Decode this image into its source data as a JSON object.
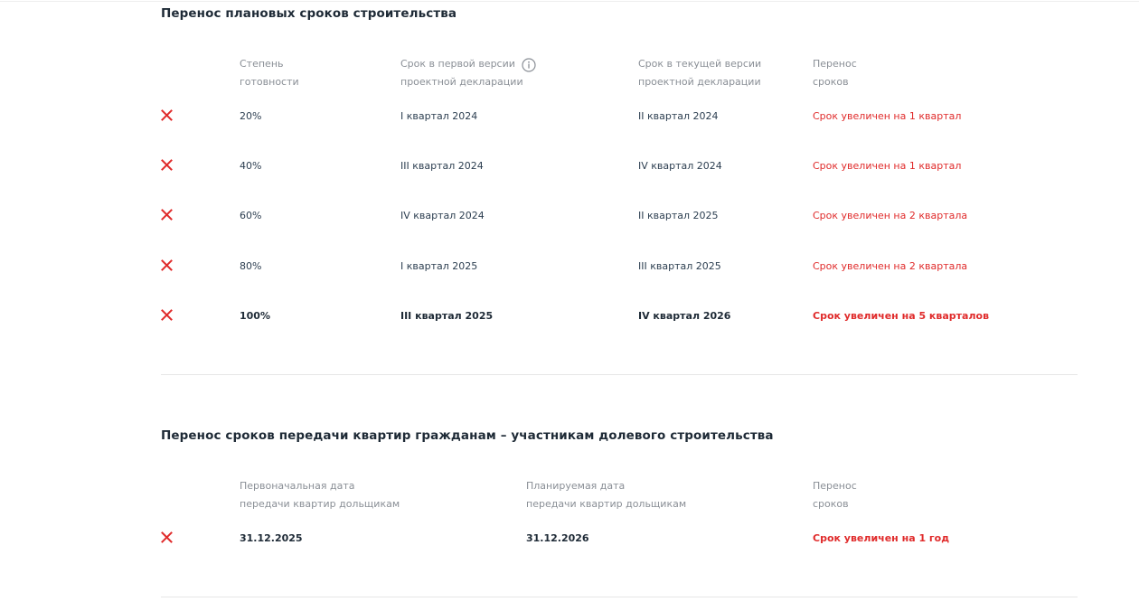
{
  "colors": {
    "title": "#1e2a36",
    "header": "#8a8f96",
    "text": "#2c3e50",
    "alert": "#e02b2b",
    "divider": "#e6e6e6"
  },
  "icons": {
    "row_status": "close-icon",
    "header_info": "info-icon"
  },
  "construction": {
    "title": "Перенос плановых сроков строительства",
    "headers": [
      {
        "line1": "Степень",
        "line2": "готовности"
      },
      {
        "line1": "Срок в первой версии",
        "line2": "проектной декларации"
      },
      {
        "line1": "Срок в текущей версии",
        "line2": "проектной декларации"
      },
      {
        "line1": "Перенос",
        "line2": "сроков"
      }
    ],
    "rows": [
      {
        "readiness": "20%",
        "first": "I квартал 2024",
        "current": "II квартал 2024",
        "shift": "Срок увеличен на 1 квартал"
      },
      {
        "readiness": "40%",
        "first": "III квартал 2024",
        "current": "IV квартал 2024",
        "shift": "Срок увеличен на 1 квартал"
      },
      {
        "readiness": "60%",
        "first": "IV квартал 2024",
        "current": "II квартал 2025",
        "shift": "Срок увеличен на 2 квартала"
      },
      {
        "readiness": "80%",
        "first": "I квартал 2025",
        "current": "III квартал 2025",
        "shift": "Срок увеличен на 2 квартала"
      },
      {
        "readiness": "100%",
        "first": "III квартал 2025",
        "current": "IV квартал 2026",
        "shift": "Срок увеличен на 5 кварталов"
      }
    ]
  },
  "handover": {
    "title": "Перенос сроков передачи квартир гражданам – участникам долевого строительства",
    "headers": [
      {
        "line1": "Первоначальная дата",
        "line2": "передачи квартир дольщикам"
      },
      {
        "line1": "Планируемая дата",
        "line2": "передачи квартир дольщикам"
      },
      {
        "line1": "Перенос",
        "line2": "сроков"
      }
    ],
    "rows": [
      {
        "initial": "31.12.2025",
        "planned": "31.12.2026",
        "shift": "Срок увеличен на 1 год"
      }
    ]
  }
}
